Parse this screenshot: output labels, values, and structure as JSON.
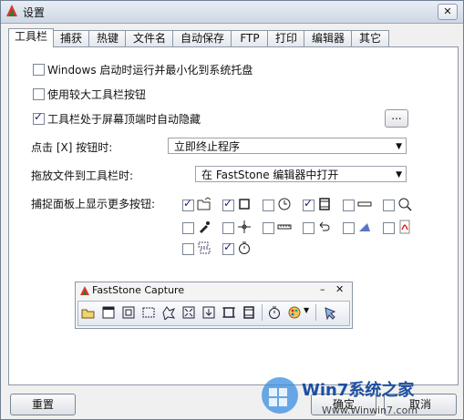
{
  "window": {
    "title": "设置"
  },
  "tabs": [
    {
      "label": "工具栏",
      "active": true
    },
    {
      "label": "捕获"
    },
    {
      "label": "热键"
    },
    {
      "label": "文件名"
    },
    {
      "label": "自动保存"
    },
    {
      "label": "FTP"
    },
    {
      "label": "打印"
    },
    {
      "label": "编辑器"
    },
    {
      "label": "其它"
    }
  ],
  "options": {
    "startup_tray": {
      "label": "Windows 启动时运行并最小化到系统托盘",
      "checked": false
    },
    "large_buttons": {
      "label": "使用较大工具栏按钮",
      "checked": false
    },
    "auto_hide": {
      "label": "工具栏处于屏幕顶端时自动隐藏",
      "checked": true
    },
    "ellipsis_label": "..."
  },
  "close_action": {
    "label": "点击 [X] 按钮时:",
    "value": "立即终止程序"
  },
  "drag_action": {
    "label": "拖放文件到工具栏时:",
    "value": "在 FastStone 编辑器中打开"
  },
  "more_buttons": {
    "label": "捕捉面板上显示更多按钮:",
    "items": [
      {
        "icon": "open-folder-icon",
        "checked": true
      },
      {
        "icon": "capture-rectangle-icon",
        "checked": true
      },
      {
        "icon": "timer-clock-icon",
        "checked": false
      },
      {
        "icon": "video-record-icon",
        "checked": true
      },
      {
        "icon": "screen-bar-icon",
        "checked": false
      },
      {
        "icon": "magnifier-icon",
        "checked": false
      },
      {
        "icon": "color-picker-icon",
        "checked": false
      },
      {
        "icon": "crosshair-icon",
        "checked": false
      },
      {
        "icon": "ruler-icon",
        "checked": false
      },
      {
        "icon": "undo-arrow-icon",
        "checked": false
      },
      {
        "icon": "scanner-icon",
        "checked": false
      },
      {
        "icon": "pdf-icon",
        "checked": false
      },
      {
        "icon": "split-region-icon",
        "checked": false
      },
      {
        "icon": "stopwatch-icon",
        "checked": true
      }
    ]
  },
  "preview": {
    "title": "FastStone Capture",
    "minimize": "–",
    "close": "✕",
    "tools": [
      "open-icon",
      "window-capture-icon",
      "object-capture-icon",
      "rectangle-capture-icon",
      "freehand-capture-icon",
      "fullscreen-capture-icon",
      "scrolling-capture-icon",
      "fixed-region-icon",
      "video-icon",
      "delay-timer-icon",
      "output-palette-icon",
      "settings-icon"
    ]
  },
  "buttons": {
    "reset": "重置",
    "ok": "确定",
    "cancel": "取消"
  },
  "watermark": {
    "text": "Win7系统之家",
    "url": "Www.Winwin7.com"
  }
}
